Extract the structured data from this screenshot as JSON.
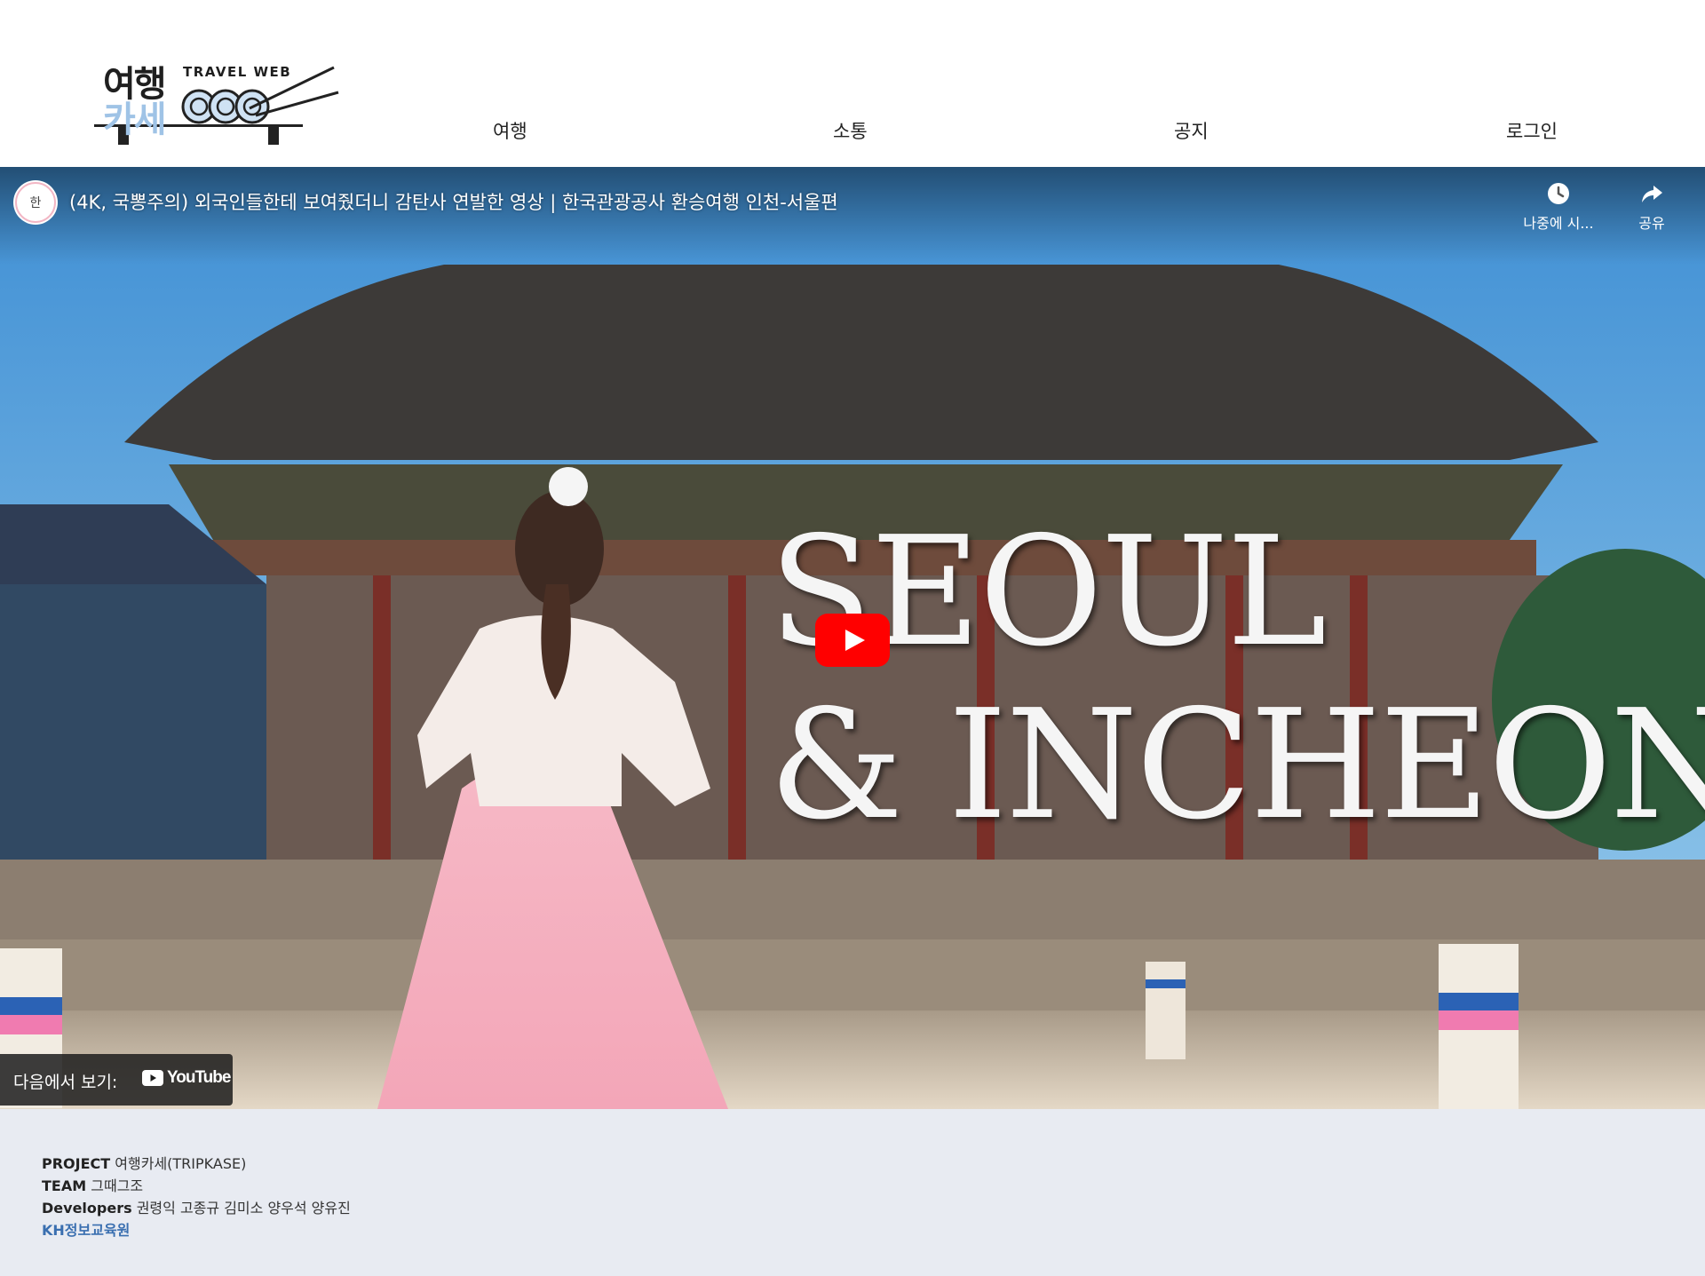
{
  "header": {
    "logo": {
      "korean_line1": "여행",
      "korean_line2": "카세",
      "english": "TRAVEL WEB"
    },
    "nav": [
      {
        "label": "여행"
      },
      {
        "label": "소통"
      },
      {
        "label": "공지"
      },
      {
        "label": "로그인"
      }
    ]
  },
  "video": {
    "title": "(4K, 국뽕주의) 외국인들한테 보여줬더니 감탄사 연발한 영상 | 한국관광공사 환승여행 인천-서울편",
    "watch_later_label": "나중에 시...",
    "share_label": "공유",
    "headline_line1": "SEOUL",
    "headline_line2": "& INCHEON",
    "watch_on_label": "다음에서 보기:",
    "youtube_wordmark": "YouTube",
    "colors": {
      "play_red": "#ff0000",
      "overlay": "#1c1c1c"
    }
  },
  "footer": {
    "project_key": "PROJECT",
    "project_value": "여행카세(TRIPKASE)",
    "team_key": "TEAM",
    "team_value": "그때그조",
    "developers_key": "Developers",
    "developers_value": "권령익 고종규 김미소 양우석 양유진",
    "org_link": "KH정보교육원",
    "colors": {
      "background": "#e8ebf2",
      "link": "#3a6fb0"
    }
  }
}
